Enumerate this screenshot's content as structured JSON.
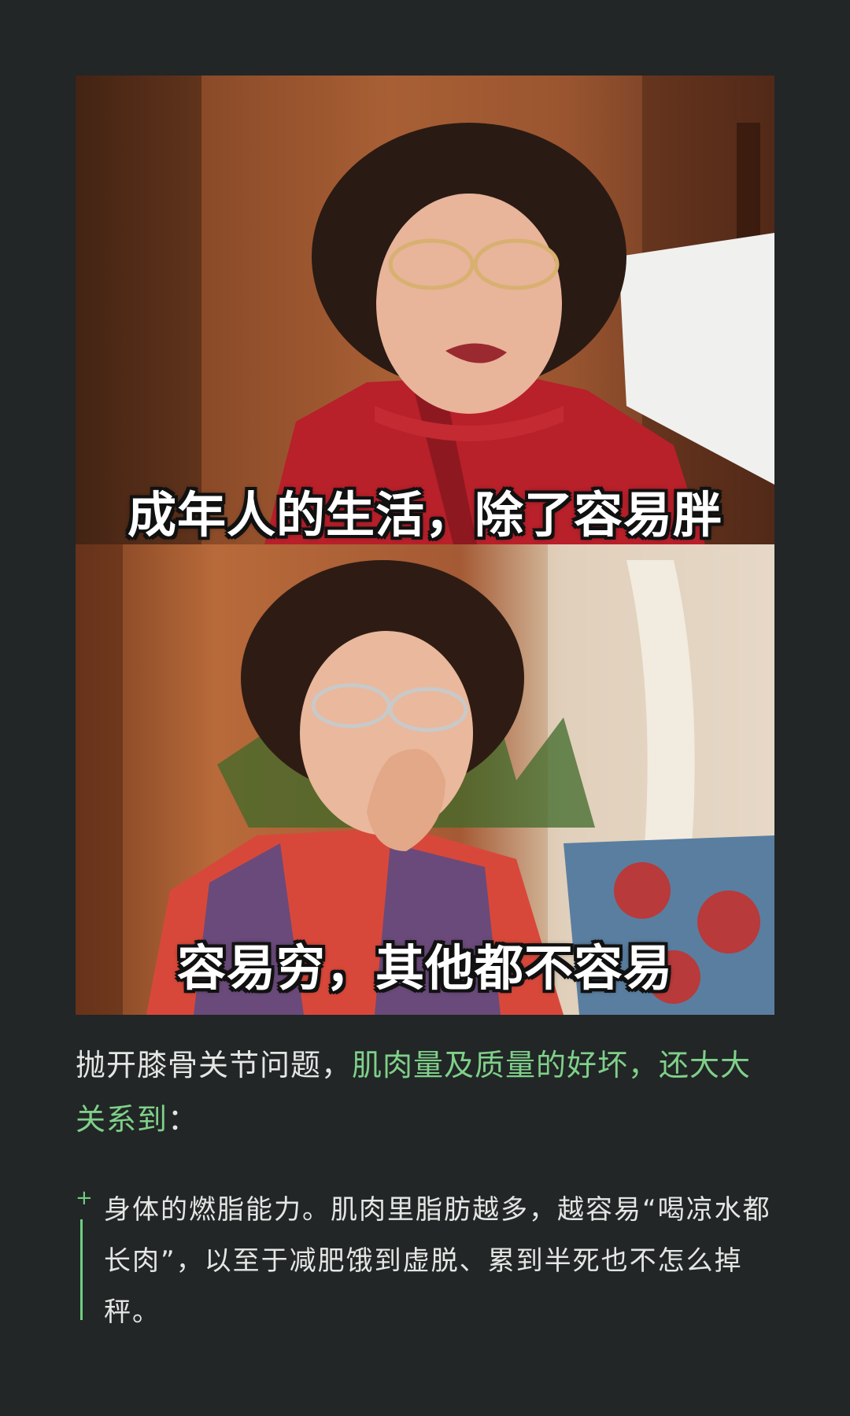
{
  "meme": {
    "caption_top": "成年人的生活，除了容易胖",
    "caption_bottom": "容易穷，其他都不容易"
  },
  "paragraph": {
    "text_plain": "抛开膝骨关节问题，",
    "text_highlight": "肌肉量及质量的好坏，还大大关系到",
    "text_end": "：",
    "highlight_color": "#7fd08a"
  },
  "bullet": {
    "marker": "+",
    "text": "身体的燃脂能力。肌肉里脂肪越多，越容易“喝凉水都长肉”，以至于减肥饿到虚脱、累到半死也不怎么掉秤。",
    "accent_color": "#6fcf80"
  },
  "theme": {
    "background": "#222626",
    "text_color": "#e4e6e4"
  }
}
